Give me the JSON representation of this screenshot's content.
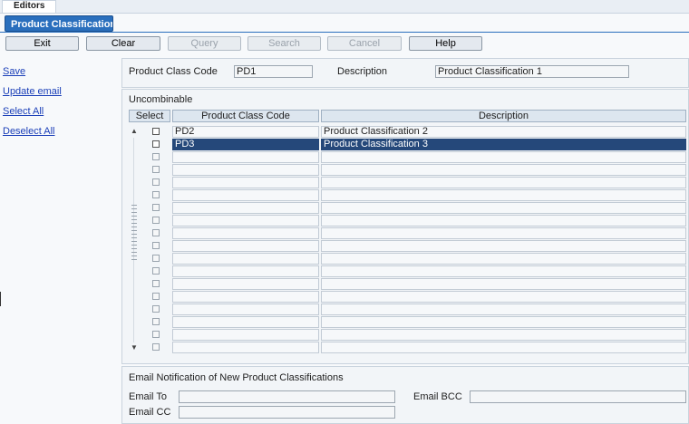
{
  "tabs": {
    "editors": "Editors",
    "document": "Product Classification ..."
  },
  "toolbar": {
    "buttons": [
      {
        "label": "Exit",
        "enabled": true
      },
      {
        "label": "Clear",
        "enabled": true
      },
      {
        "label": "Query",
        "enabled": false
      },
      {
        "label": "Search",
        "enabled": false
      },
      {
        "label": "Cancel",
        "enabled": false
      },
      {
        "label": "Help",
        "enabled": true
      }
    ]
  },
  "links": [
    "Save",
    "Update email",
    "Select All",
    "Deselect All"
  ],
  "header": {
    "code_label": "Product Class Code",
    "code_value": "PD1",
    "desc_label": "Description",
    "desc_value": "Product Classification 1"
  },
  "grid": {
    "section_title": "Uncombinable",
    "columns": [
      "Select",
      "Product Class Code",
      "Description"
    ],
    "rows": [
      {
        "select": false,
        "code": "PD2",
        "description": "Product Classification 2",
        "selected": false
      },
      {
        "select": false,
        "code": "PD3",
        "description": "Product Classification 3",
        "selected": true
      },
      {
        "select": false,
        "code": "",
        "description": ""
      },
      {
        "select": false,
        "code": "",
        "description": ""
      },
      {
        "select": false,
        "code": "",
        "description": ""
      },
      {
        "select": false,
        "code": "",
        "description": ""
      },
      {
        "select": false,
        "code": "",
        "description": ""
      },
      {
        "select": false,
        "code": "",
        "description": ""
      },
      {
        "select": false,
        "code": "",
        "description": ""
      },
      {
        "select": false,
        "code": "",
        "description": ""
      },
      {
        "select": false,
        "code": "",
        "description": ""
      },
      {
        "select": false,
        "code": "",
        "description": ""
      },
      {
        "select": false,
        "code": "",
        "description": ""
      },
      {
        "select": false,
        "code": "",
        "description": ""
      },
      {
        "select": false,
        "code": "",
        "description": ""
      },
      {
        "select": false,
        "code": "",
        "description": ""
      },
      {
        "select": false,
        "code": "",
        "description": ""
      },
      {
        "select": false,
        "code": "",
        "description": ""
      }
    ]
  },
  "email": {
    "section_title": "Email Notification of New Product Classifications",
    "to_label": "Email To",
    "to_value": "",
    "bcc_label": "Email BCC",
    "bcc_value": "",
    "cc_label": "Email CC",
    "cc_value": ""
  }
}
